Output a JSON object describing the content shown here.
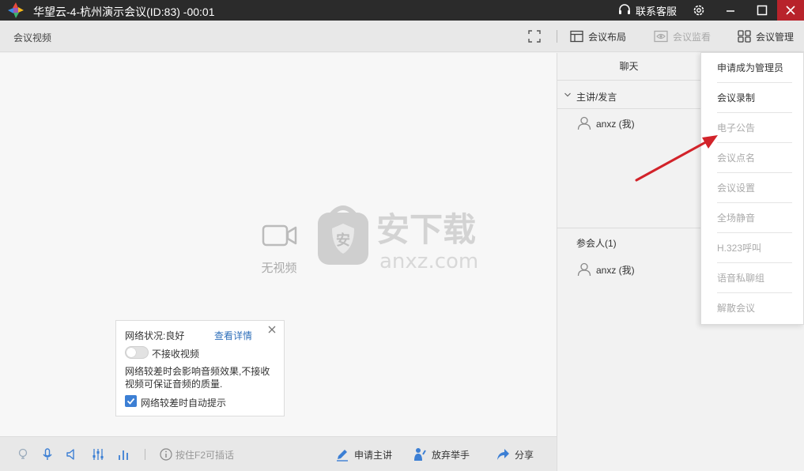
{
  "window": {
    "title": "华望云-4-杭州演示会议(ID:83) -00:01",
    "support_label": "联系客服"
  },
  "toolbar": {
    "section_label": "会议视频",
    "layout_label": "会议布局",
    "monitor_label": "会议监看",
    "manage_label": "会议管理"
  },
  "video": {
    "no_video_text": "无视频",
    "watermark_text": "安下载",
    "watermark_url": "anxz.com"
  },
  "network_panel": {
    "status_text": "网络状况:良好",
    "detail_link": "查看详情",
    "toggle_label": "不接收视频",
    "description": "网络较差时会影响音频效果,不接收视频可保证音频的质量.",
    "auto_hint_label": "网络较差时自动提示",
    "auto_hint_checked": true
  },
  "bottombar": {
    "hint_text": "按住F2可插话",
    "apply_speaker_label": "申请主讲",
    "lower_hand_label": "放弃举手",
    "share_label": "分享"
  },
  "side_panel": {
    "tab_label": "聊天",
    "speaker_section_label": "主讲/发言",
    "speakers": [
      {
        "name": "anxz (我)"
      }
    ],
    "participants_section_label": "参会人(1)",
    "participants": [
      {
        "name": "anxz (我)"
      }
    ]
  },
  "manage_menu": {
    "items": [
      {
        "label": "申请成为管理员",
        "enabled": true
      },
      {
        "label": "会议录制",
        "enabled": true
      },
      {
        "label": "电子公告",
        "enabled": false
      },
      {
        "label": "会议点名",
        "enabled": false
      },
      {
        "label": "会议设置",
        "enabled": false
      },
      {
        "label": "全场静音",
        "enabled": false
      },
      {
        "label": "H.323呼叫",
        "enabled": false
      },
      {
        "label": "语音私聊组",
        "enabled": false
      },
      {
        "label": "解散会议",
        "enabled": false
      }
    ]
  },
  "colors": {
    "titlebar": "#2b2b2b",
    "close_button": "#b8232b",
    "link": "#2f6fba",
    "checkbox": "#3c7fd4",
    "annotation_arrow": "#d2232a"
  }
}
